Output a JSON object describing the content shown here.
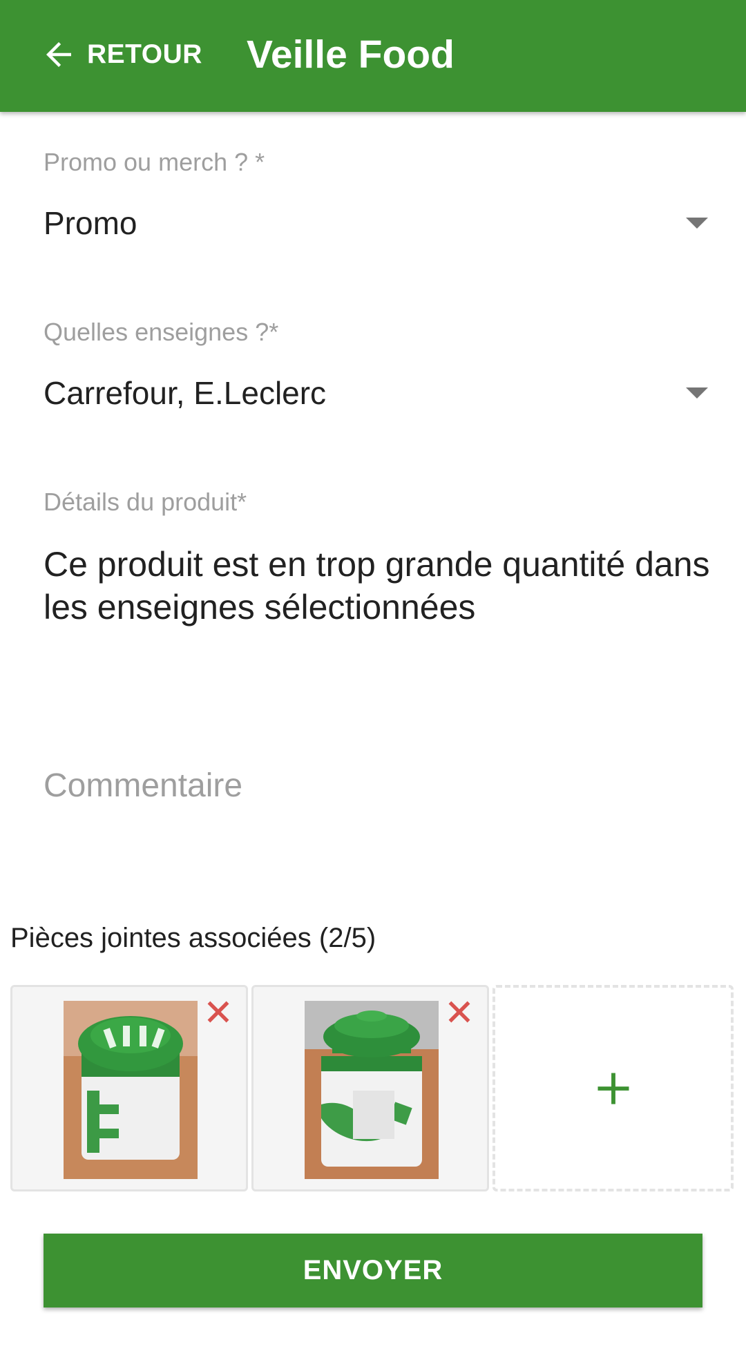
{
  "header": {
    "back_label": "RETOUR",
    "title": "Veille Food"
  },
  "form": {
    "type_field": {
      "label": "Promo ou merch ? *",
      "value": "Promo"
    },
    "stores_field": {
      "label": "Quelles enseignes ?*",
      "value": "Carrefour, E.Leclerc"
    },
    "details_field": {
      "label": "Détails du produit*",
      "value": "Ce produit est en trop grande quantité dans les enseignes sélectionnées"
    },
    "comment_field": {
      "placeholder": "Commentaire",
      "value": ""
    }
  },
  "attachments": {
    "title": "Pièces jointes associées (2/5)",
    "items": [
      {
        "icon": "photo-tea-tin-the-lettering"
      },
      {
        "icon": "photo-tea-tin-leaves"
      }
    ],
    "add_icon": "plus-icon"
  },
  "actions": {
    "send_label": "ENVOYER"
  },
  "colors": {
    "primary": "#3d9232",
    "remove": "#d9534f",
    "hint": "#9e9e9e"
  }
}
